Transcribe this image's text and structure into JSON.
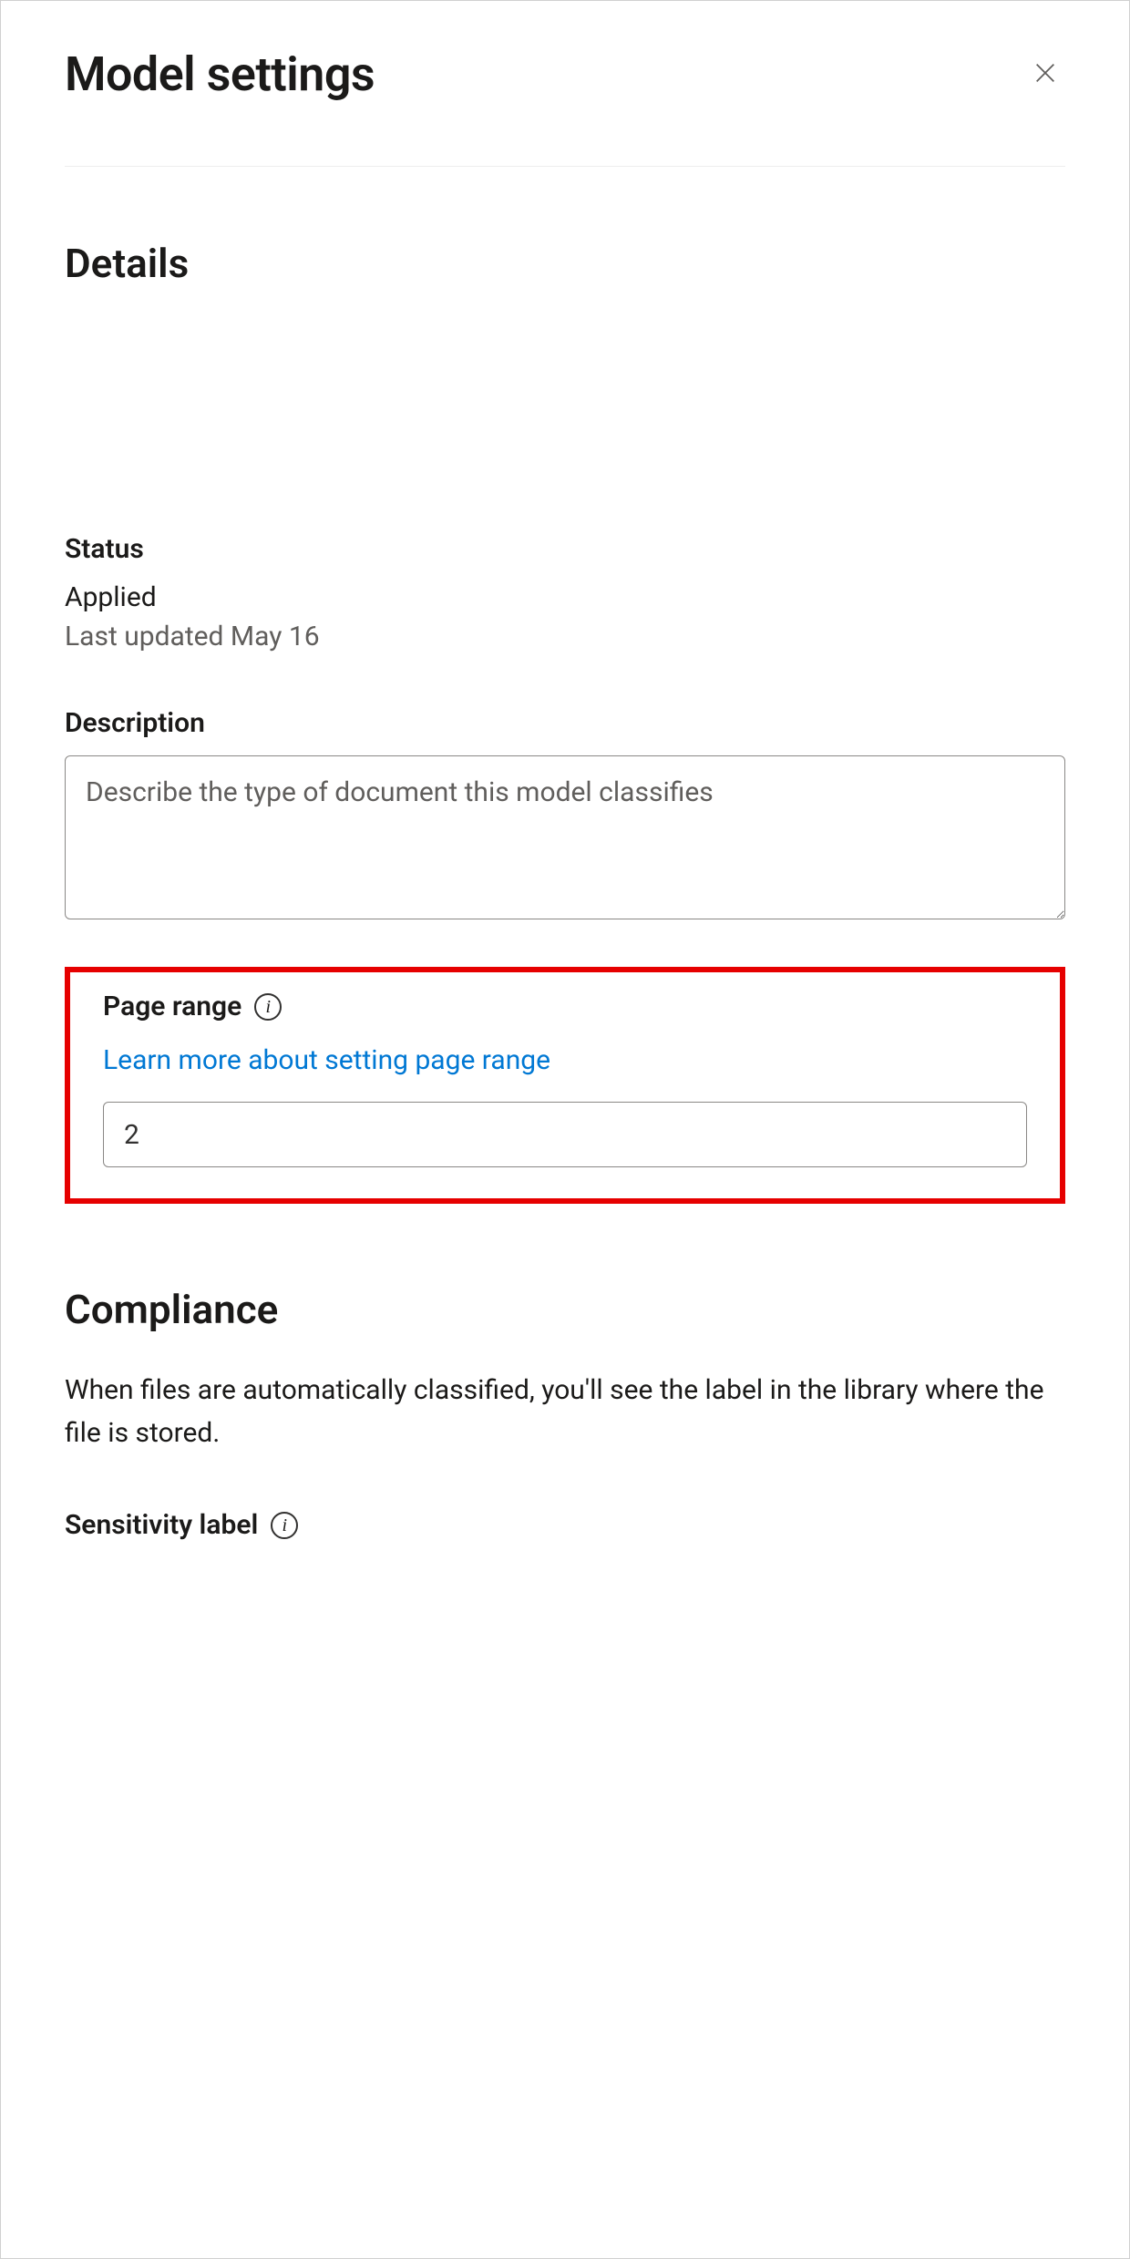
{
  "panel": {
    "title": "Model settings"
  },
  "details": {
    "heading": "Details",
    "status": {
      "label": "Status",
      "value": "Applied",
      "updated": "Last updated May 16"
    },
    "description": {
      "label": "Description",
      "placeholder": "Describe the type of document this model classifies",
      "value": ""
    },
    "page_range": {
      "label": "Page range",
      "learn_more": "Learn more about setting page range",
      "value": "2"
    }
  },
  "compliance": {
    "heading": "Compliance",
    "body": "When files are automatically classified, you'll see the label in the library where the file is stored.",
    "sensitivity": {
      "label": "Sensitivity label"
    }
  }
}
